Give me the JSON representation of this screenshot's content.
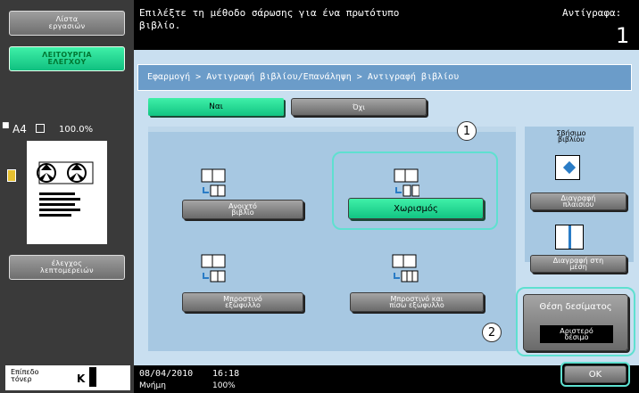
{
  "left_panel": {
    "job_list": "Λίστα\nεργασιών",
    "check_function": "ΛΕΙΤΟΥΡΓΙΑ\nΕΛΕΓΧΟΥ",
    "paper_size": "A4",
    "zoom": "100.0%",
    "check_details": "έλεγχος\nλεπτομερειών",
    "toner_label": "Επίπεδο\nτόνερ",
    "toner_letter": "K"
  },
  "message": {
    "text": "Επιλέξτε τη μέθοδο σάρωσης για ένα πρωτότυπο\nβιβλίο.",
    "copies_label": "Αντίγραφα:",
    "copies_value": "1"
  },
  "breadcrumb": "Εφαρμογή > Αντιγραφή βιβλίου/Επανάληψη > Αντιγραφή βιβλίου",
  "toggle": {
    "yes": "Ναι",
    "no": "Όχι"
  },
  "options": {
    "open_book": "Ανοιχτό\nβιβλίο",
    "separation": "Χωρισμός",
    "front_cover": "Μπροστινό\nεξώφυλλο",
    "front_back_cover": "Μπροστινό και\nπίσω εξώφυλλο"
  },
  "side_panel": {
    "title": "Σβήσιμο\nβιβλίου",
    "frame_erase": "Διαγραφή\nπλαισίου",
    "center_erase": "Διαγραφή στη\nμέση",
    "binding_title": "Θέση δεσίματος",
    "binding_value": "Αριστερό\nδέσιμο"
  },
  "callouts": {
    "one": "1",
    "two": "2"
  },
  "ok": "OK",
  "status": {
    "date": "08/04/2010",
    "time": "16:18",
    "memory_label": "Μνήμη",
    "memory_value": "100%"
  }
}
